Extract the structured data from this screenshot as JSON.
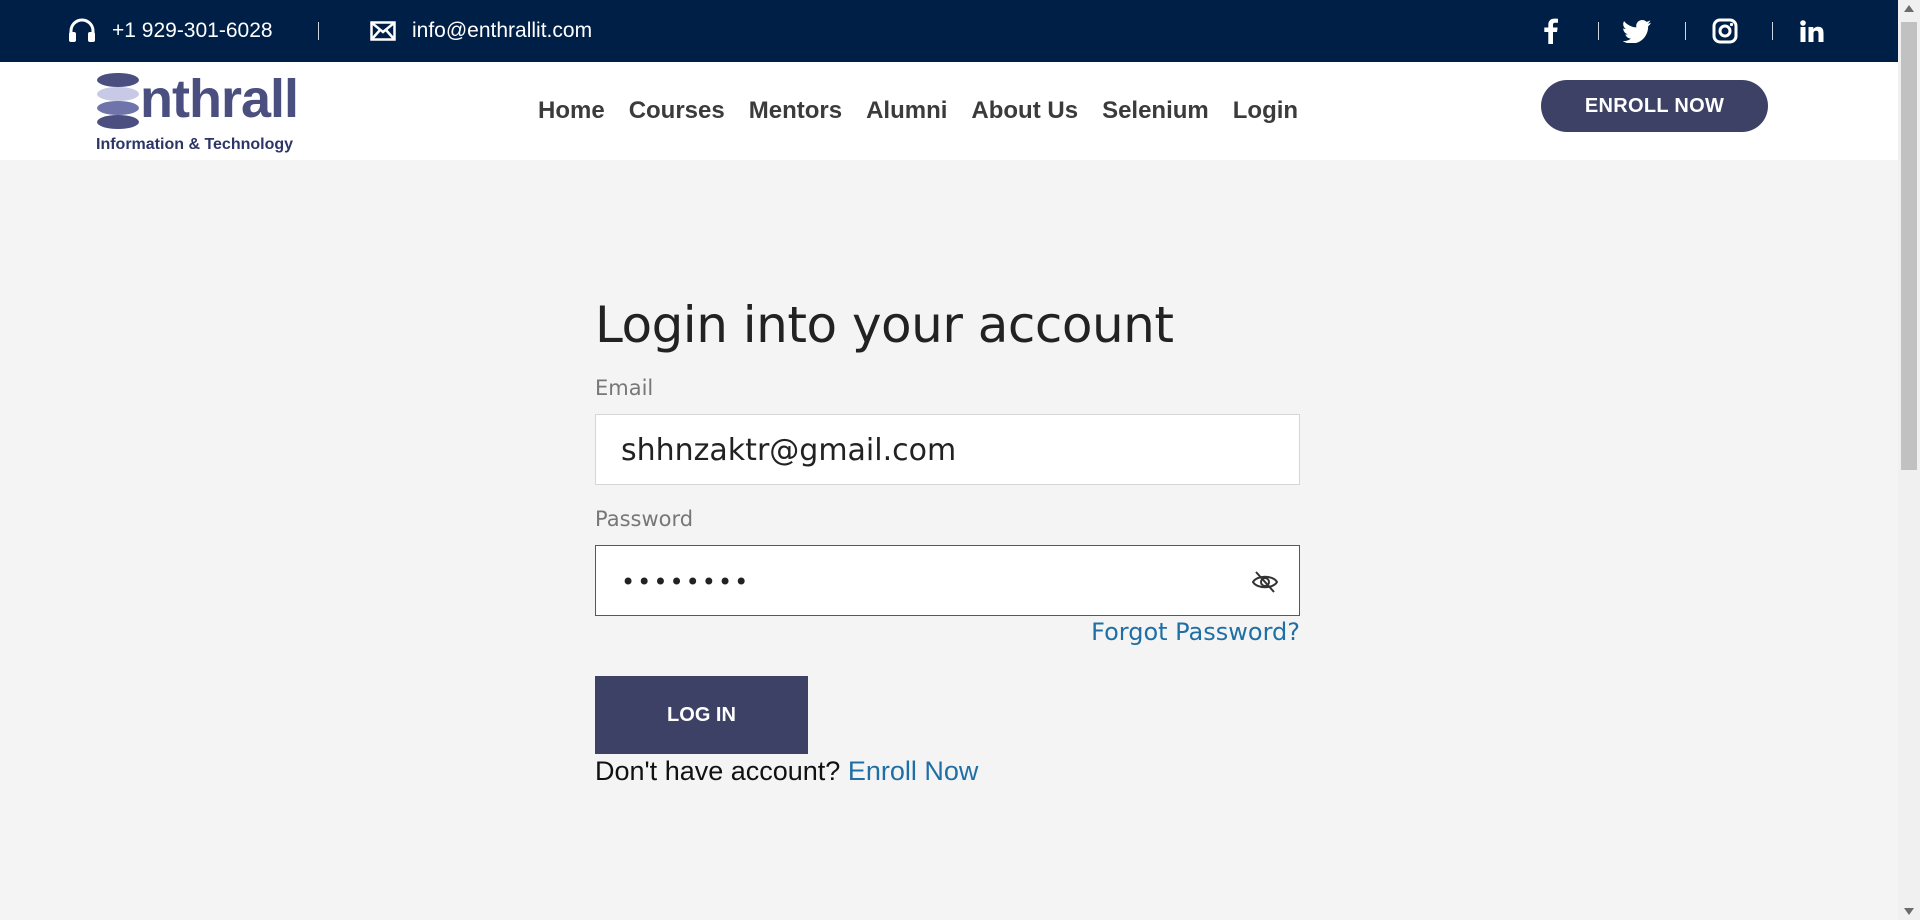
{
  "topbar": {
    "phone": "+1 929-301-6028",
    "email": "info@enthrallit.com",
    "socials": [
      "facebook",
      "twitter",
      "instagram",
      "linkedin"
    ]
  },
  "header": {
    "logo_word": "Enthrall",
    "logo_tag": "Information & Technology",
    "nav": [
      "Home",
      "Courses",
      "Mentors",
      "Alumni",
      "About Us",
      "Selenium",
      "Login"
    ],
    "enroll_label": "ENROLL NOW"
  },
  "login": {
    "title": "Login into your account",
    "email_label": "Email",
    "email_value": "shhnzaktr@gmail.com",
    "password_label": "Password",
    "password_value": "••••••••",
    "forgot": "Forgot Password?",
    "login_button": "LOG IN",
    "signup_prompt": "Don't have account?",
    "signup_link": "Enroll Now"
  },
  "colors": {
    "topbar_bg": "#001f47",
    "brand": "#3d4166",
    "link": "#1f6fa6",
    "page_bg": "#f4f4f4"
  }
}
